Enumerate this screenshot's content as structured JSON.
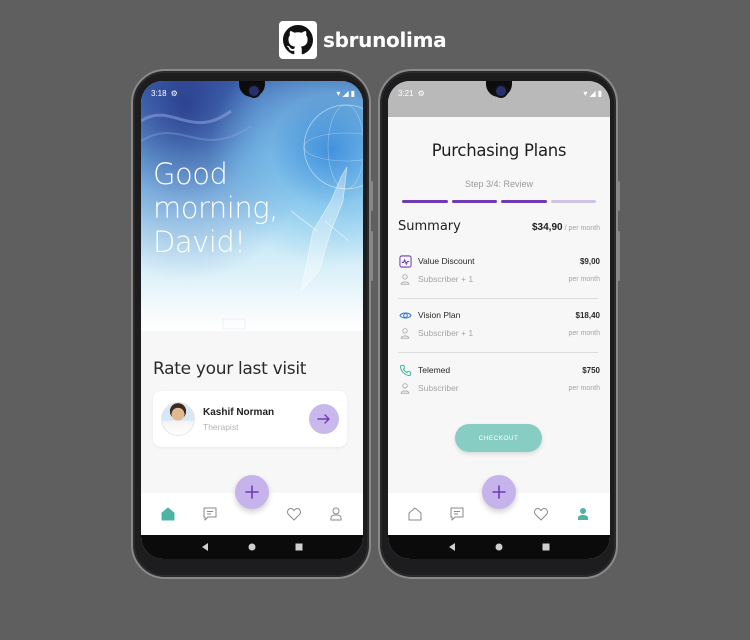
{
  "header": {
    "username": "sbrunolima"
  },
  "left_screen": {
    "status": {
      "time": "3:18"
    },
    "greeting": {
      "line1": "Good",
      "line2": "morning,",
      "line3": "David!"
    },
    "rate_title": "Rate your last visit",
    "card": {
      "name": "Kashif Norman",
      "role": "Therapist"
    },
    "nav": {
      "active": "home"
    }
  },
  "right_screen": {
    "status": {
      "time": "3:21"
    },
    "title": "Purchasing Plans",
    "step": "Step 3/4: Review",
    "progress": {
      "current": 3,
      "total": 4
    },
    "summary": {
      "label": "Summary",
      "price": "$34,90",
      "period": "/ per month"
    },
    "plans": [
      {
        "name": "Value Discount",
        "price": "$9,00",
        "sub": "Subscriber + 1",
        "period": "per month",
        "icon": "wave-icon",
        "color": "#6f3bb4"
      },
      {
        "name": "Vision Plan",
        "price": "$18,40",
        "sub": "Subscriber + 1",
        "period": "per month",
        "icon": "eye-icon",
        "color": "#3a7bd5"
      },
      {
        "name": "Telemed",
        "price": "$750",
        "sub": "Subscriber",
        "period": "per month",
        "icon": "phone-icon",
        "color": "#3fb5a6"
      }
    ],
    "checkout_label": "CHECKOUT",
    "nav": {
      "active": "profile"
    }
  },
  "colors": {
    "accent_purple": "#c7b3eb",
    "step_purple": "#6f3bb4",
    "teal": "#4db3a4",
    "checkout": "#88cdc3"
  }
}
